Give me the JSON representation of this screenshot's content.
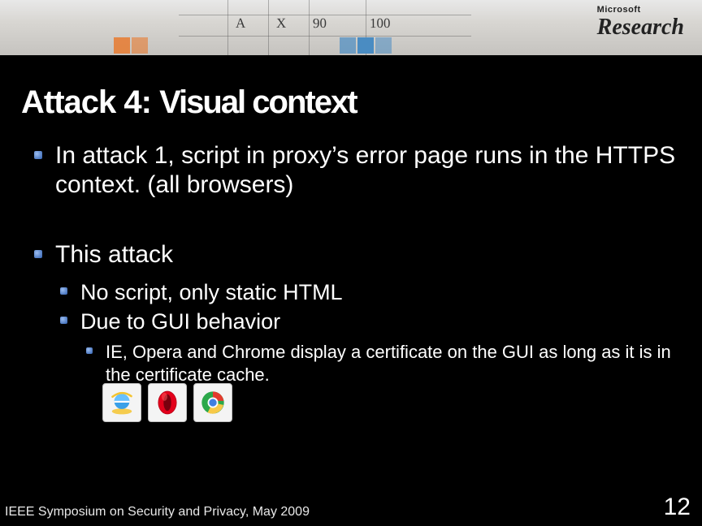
{
  "banner": {
    "brand_line1_a": "Microsoft",
    "brand_line2": "Research",
    "whiteboard_marks": [
      "A",
      "X",
      "90",
      "100"
    ]
  },
  "slide": {
    "title_prefix": "Attack 4: ",
    "title_keywords": "Visual context",
    "bullets": {
      "b1": "In attack 1, script in proxy’s error page runs in the HTTPS context. (all browsers)",
      "b2": "This attack",
      "b2_1": "No script, only static HTML",
      "b2_2": "Due to GUI behavior",
      "b2_2_1": "IE, Opera and Chrome display a certificate on the GUI as long as it is in the certificate cache."
    },
    "icons": [
      "ie-icon",
      "opera-icon",
      "chrome-icon"
    ]
  },
  "footer": {
    "venue": "IEEE Symposium on Security and Privacy, May 2009",
    "page": "12"
  }
}
